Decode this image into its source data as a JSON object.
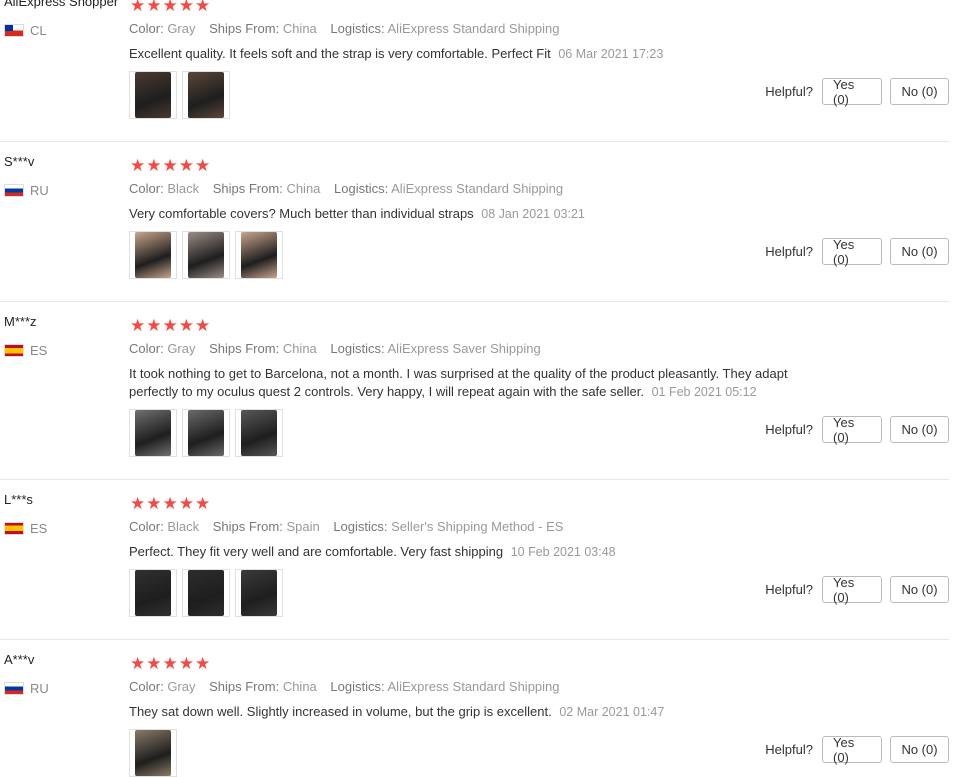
{
  "labels": {
    "color": "Color:",
    "ships_from": "Ships From:",
    "logistics": "Logistics:",
    "helpful": "Helpful?"
  },
  "colors": {
    "star": "#f04b4b",
    "meta_text": "#999999",
    "divider": "#e8e8e8"
  },
  "reviews": [
    {
      "user": "AliExpress Shopper",
      "country": "CL",
      "flag": "flag-cl",
      "rating": 5,
      "color": "Gray",
      "ships_from": "China",
      "logistics": "AliExpress Standard Shipping",
      "text": "Excellent quality. It feels soft and the strap is very comfortable. Perfect Fit",
      "date": "06 Mar 2021 17:23",
      "photos": [
        "controller-photo",
        "controller-photo"
      ],
      "yes": "Yes (0)",
      "no": "No (0)"
    },
    {
      "user": "S***v",
      "country": "RU",
      "flag": "flag-ru",
      "rating": 5,
      "color": "Black",
      "ships_from": "China",
      "logistics": "AliExpress Standard Shipping",
      "text": "Very comfortable covers? Much better than individual straps",
      "date": "08 Jan 2021 03:21",
      "photos": [
        "controller-photo",
        "controller-photo",
        "controller-photo"
      ],
      "yes": "Yes (0)",
      "no": "No (0)"
    },
    {
      "user": "M***z",
      "country": "ES",
      "flag": "flag-es",
      "rating": 5,
      "color": "Gray",
      "ships_from": "China",
      "logistics": "AliExpress Saver Shipping",
      "text": "It took nothing to get to Barcelona, not a month. I was surprised at the quality of the product pleasantly. They adapt perfectly to my oculus quest 2 controls. Very happy, I will repeat again with the safe seller.",
      "date": "01 Feb 2021 05:12",
      "photos": [
        "controller-photo",
        "controller-photo",
        "controller-photo"
      ],
      "yes": "Yes (0)",
      "no": "No (0)"
    },
    {
      "user": "L***s",
      "country": "ES",
      "flag": "flag-es",
      "rating": 5,
      "color": "Black",
      "ships_from": "Spain",
      "logistics": "Seller's Shipping Method - ES",
      "text": "Perfect. They fit very well and are comfortable. Very fast shipping",
      "date": "10 Feb 2021 03:48",
      "photos": [
        "controller-photo",
        "controller-photo",
        "controller-photo"
      ],
      "yes": "Yes (0)",
      "no": "No (0)"
    },
    {
      "user": "A***v",
      "country": "RU",
      "flag": "flag-ru",
      "rating": 5,
      "color": "Gray",
      "ships_from": "China",
      "logistics": "AliExpress Standard Shipping",
      "text": "They sat down well. Slightly increased in volume, but the grip is excellent.",
      "date": "02 Mar 2021 01:47",
      "photos": [
        "controller-photo"
      ],
      "yes": "Yes (0)",
      "no": "No (0)"
    }
  ]
}
